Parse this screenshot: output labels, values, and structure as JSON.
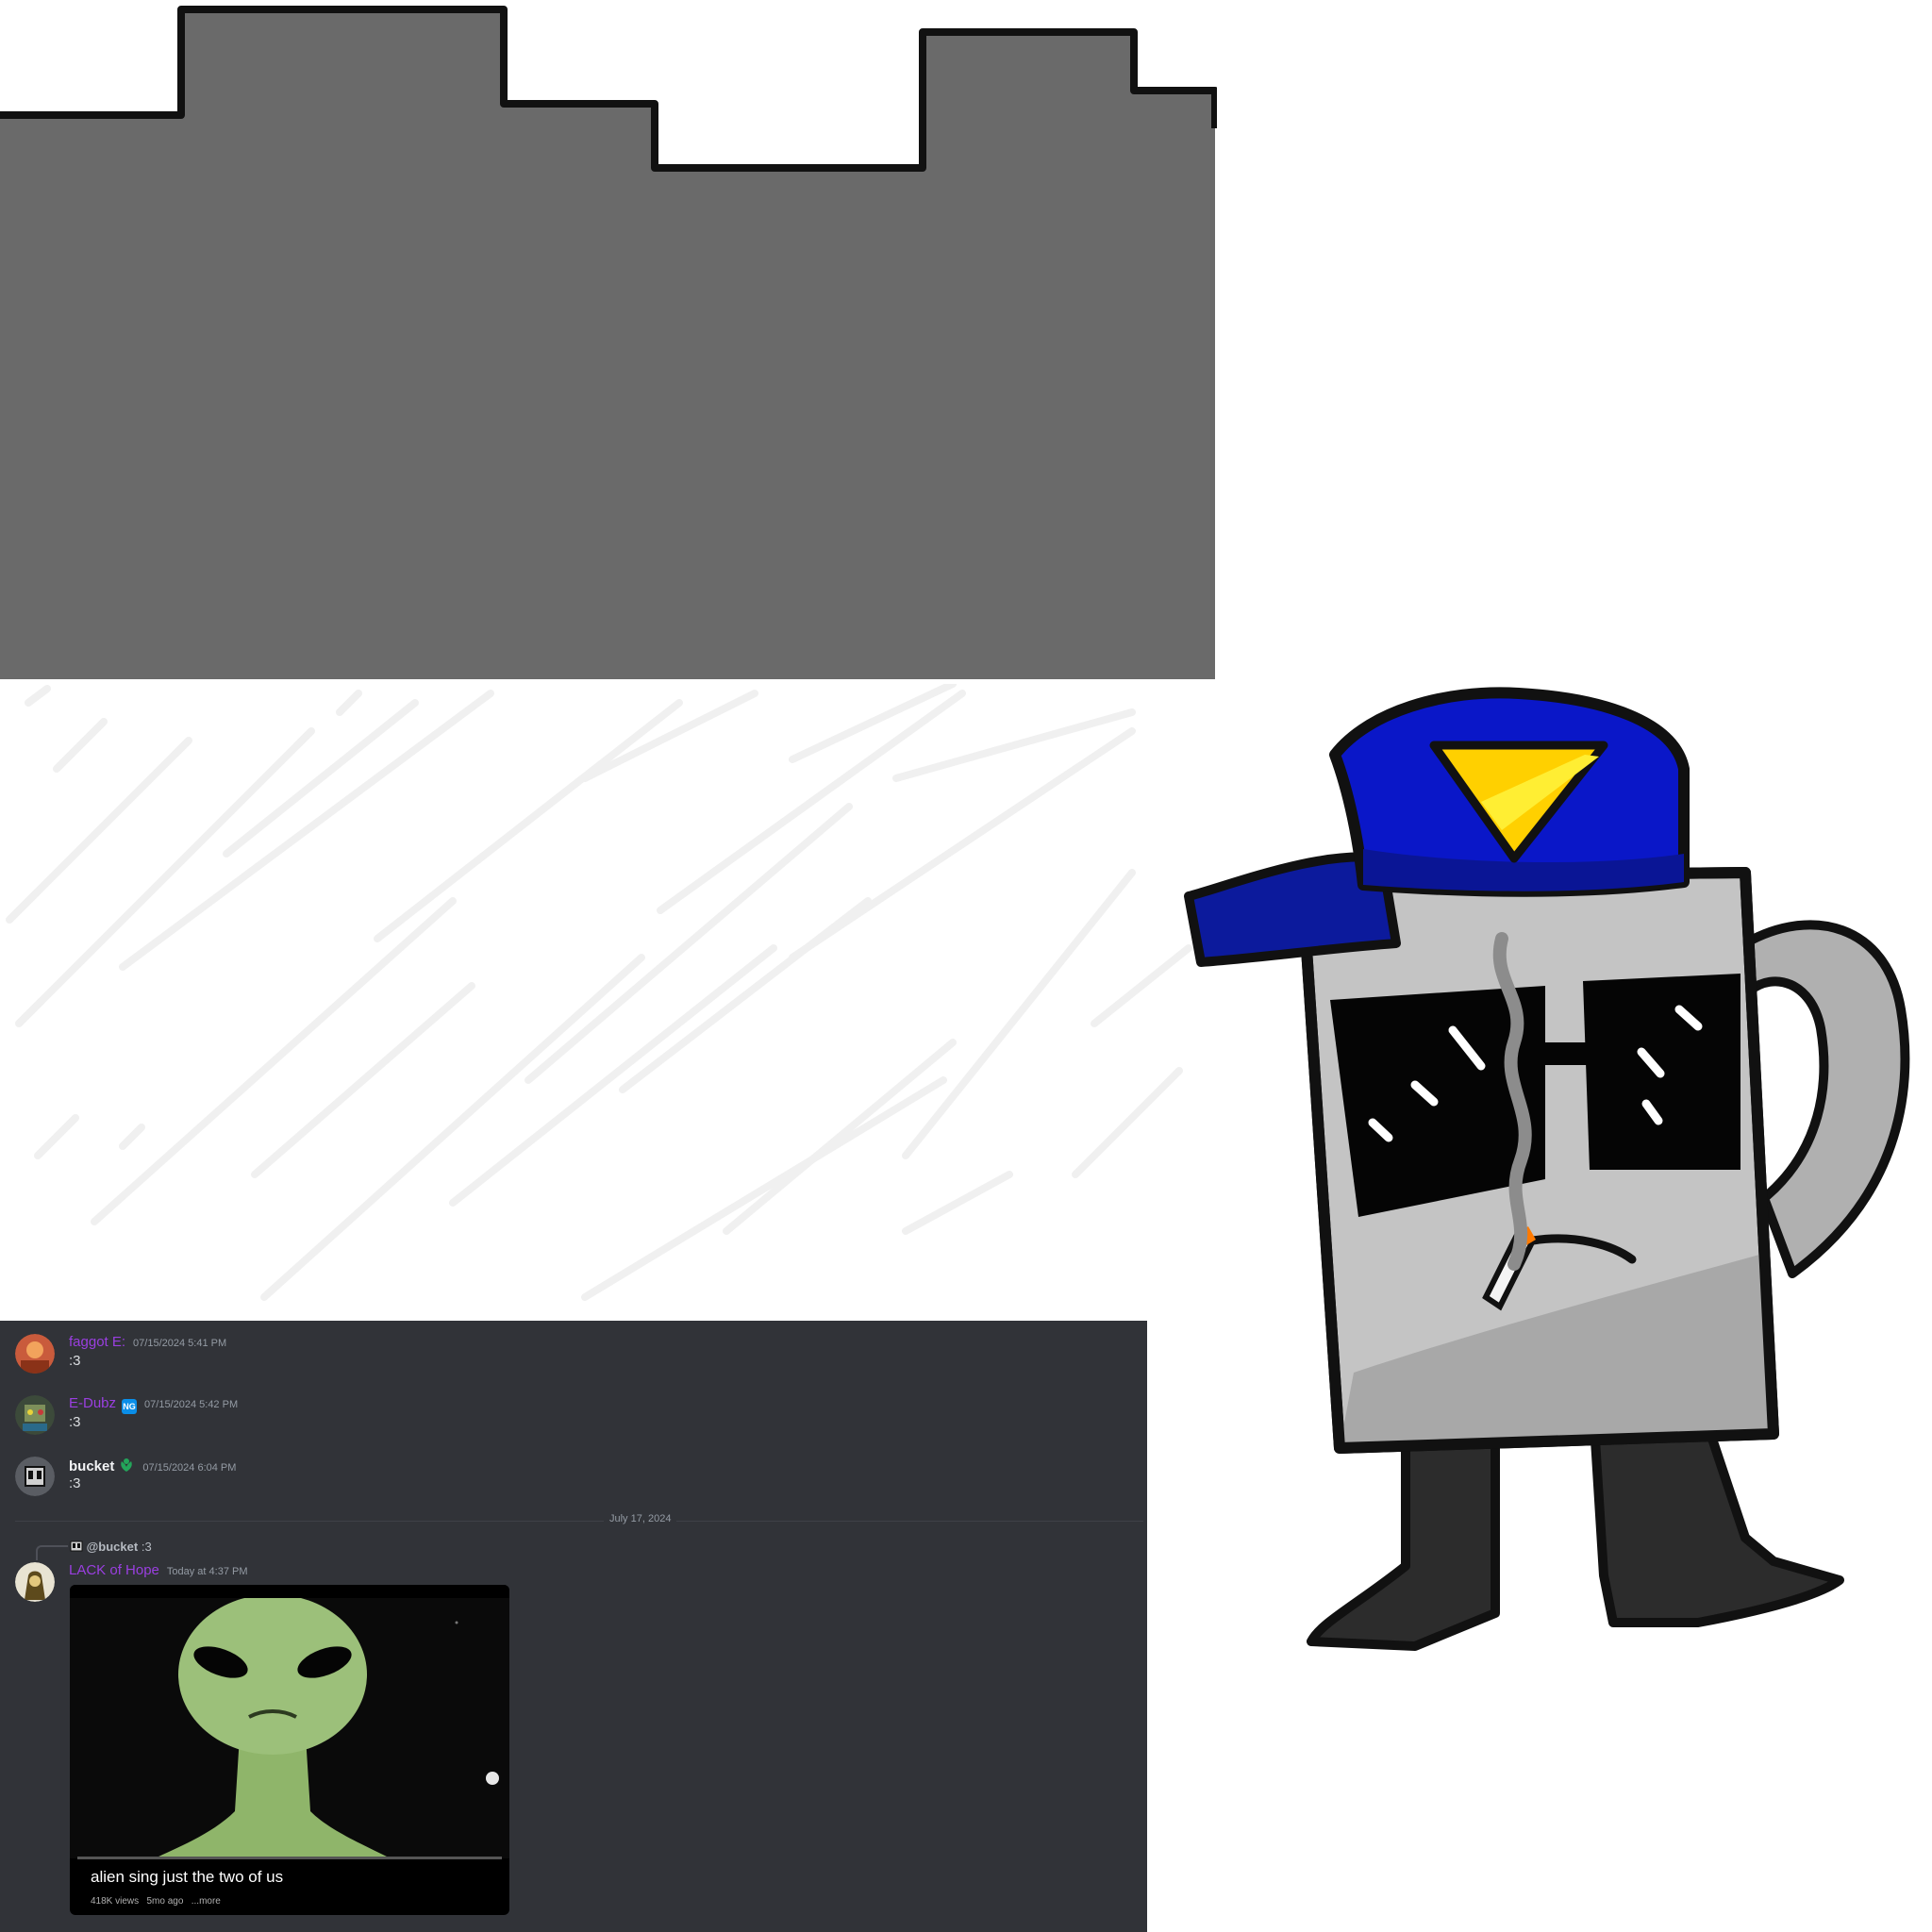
{
  "colors": {
    "skyline_fill": "#6a6a6a",
    "chat_bg": "#313338",
    "username_purple": "#9a3fe0",
    "hat_blue": "#0a17c8",
    "mug_grey": "#c4c4c4",
    "nitro_badge": "#0a8ee8",
    "leaf_badge": "#23a55a"
  },
  "chat": {
    "messages": [
      {
        "username": "faggot E:",
        "timestamp": "07/15/2024 5:41 PM",
        "text": ":3",
        "avatar": "red-avatar",
        "badge": ""
      },
      {
        "username": "E-Dubz",
        "timestamp": "07/15/2024 5:42 PM",
        "text": ":3",
        "avatar": "robot-avatar",
        "badge": "NG"
      },
      {
        "username": "bucket",
        "timestamp": "07/15/2024 6:04 PM",
        "text": ":3",
        "avatar": "bucket-avatar",
        "badge": "leaf-icon"
      }
    ],
    "date_divider": "July 17, 2024",
    "reply": {
      "reply_to": "@bucket",
      "reply_snippet": ":3",
      "username": "LACK of Hope",
      "timestamp": "Today at 4:37 PM",
      "avatar": "hooded-avatar",
      "embed": {
        "title": "alien sing just the two of us",
        "views": "418K views",
        "age": "5mo ago",
        "more": "...more"
      }
    }
  }
}
